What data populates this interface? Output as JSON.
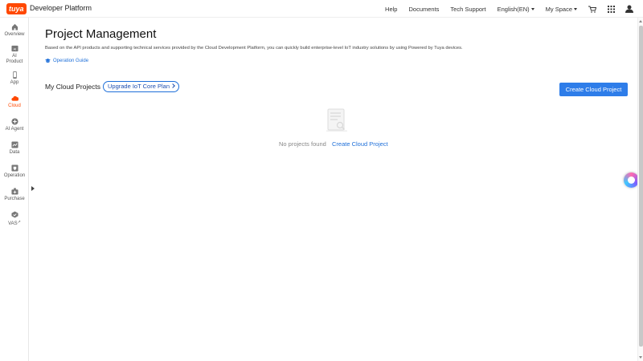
{
  "header": {
    "logo_text": "tuya",
    "brand_title": "Developer Platform",
    "nav": [
      "Help",
      "Documents",
      "Tech Support"
    ],
    "language": "English(EN)",
    "space": "My Space",
    "icons": [
      "cart-icon",
      "apps-grid-icon",
      "user-icon"
    ]
  },
  "sidebar": {
    "items": [
      {
        "label": "Overview",
        "icon": "home-icon"
      },
      {
        "label": "AI Product",
        "icon": "ai-product-icon"
      },
      {
        "label": "App",
        "icon": "phone-icon"
      },
      {
        "label": "Cloud",
        "icon": "cloud-icon",
        "active": true
      },
      {
        "label": "AI Agent",
        "icon": "agent-icon"
      },
      {
        "label": "Data",
        "icon": "chart-icon"
      },
      {
        "label": "Operation",
        "icon": "operation-icon"
      },
      {
        "label": "Purchase",
        "icon": "purchase-icon"
      },
      {
        "label": "VAS",
        "icon": "vas-icon"
      }
    ]
  },
  "main": {
    "title": "Project Management",
    "description": "Based on the API products and supporting technical services provided by the Cloud Development Platform, you can quickly build enterprise-level IoT industry solutions by using Powered by Tuya devices.",
    "guide_link": "Operation Guide",
    "section_title": "My Cloud Projects",
    "upgrade_label": "Upgrade IoT Core Plan",
    "create_button": "Create Cloud Project",
    "empty_text": "No projects found",
    "empty_link": "Create Cloud Project"
  },
  "colors": {
    "brand": "#ff4800",
    "primary": "#2e7de9",
    "link": "#1e6fd9"
  }
}
